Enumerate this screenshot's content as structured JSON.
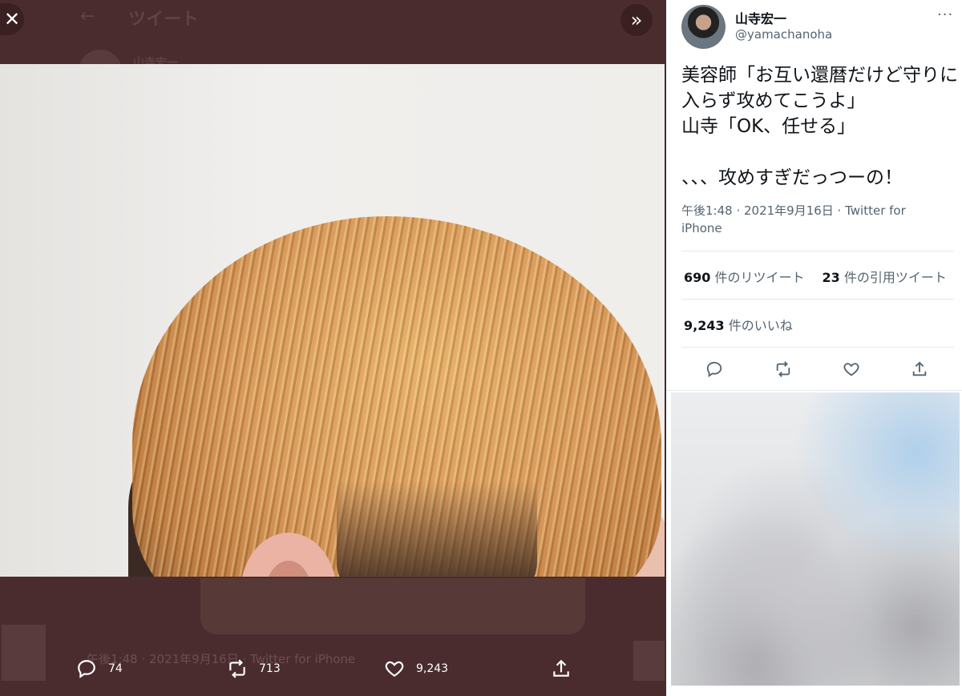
{
  "background_page": {
    "back_glyph": "←",
    "title": "ツイート",
    "author": "山寺宏一"
  },
  "viewer": {
    "close_glyph": "✕",
    "expand_glyph": "»",
    "ghost_timestamp": "午後1:48 · 2021年9月16日 · Twitter for iPhone",
    "actions": {
      "reply_count": "74",
      "retweet_count": "713",
      "like_count": "9,243"
    }
  },
  "tweet": {
    "display_name": "山寺宏一",
    "handle": "@yamachanoha",
    "more_glyph": "···",
    "text": "美容師「お互い還暦だけど守りに入らず攻めてこうよ」\n山寺「OK、任せる」\n\n、、、攻めすぎだっつーの！",
    "meta": "午後1:48 · 2021年9月16日 · Twitter for iPhone",
    "retweets": {
      "count": "690",
      "label": "件のリツイート"
    },
    "quotes": {
      "count": "23",
      "label": "件の引用ツイート"
    },
    "likes": {
      "count": "9,243",
      "label": "件のいいね"
    }
  },
  "colors": {
    "overlay": "#4a2c2e",
    "text_primary": "#0f1419",
    "text_secondary": "#536471"
  }
}
